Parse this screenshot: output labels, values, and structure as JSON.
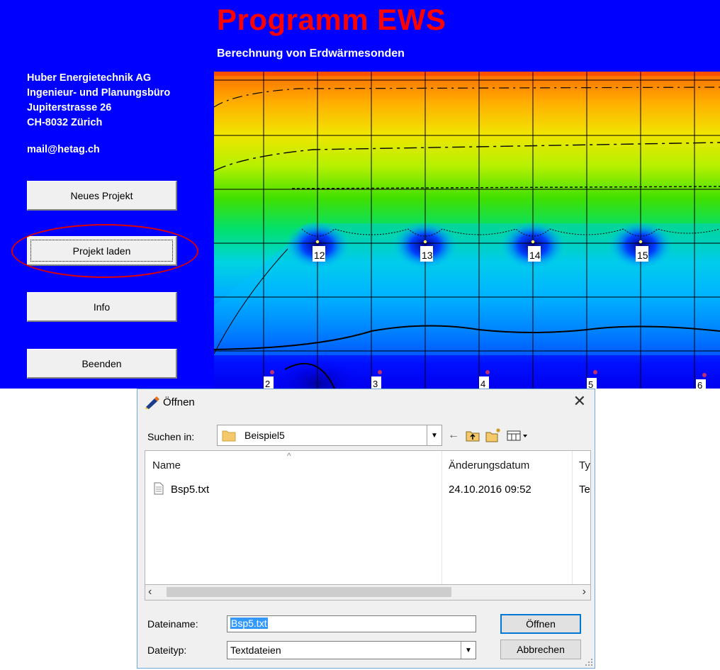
{
  "app": {
    "title": "Programm EWS",
    "subtitle": "Berechnung von Erdwärmesonden",
    "address": [
      "Huber Energietechnik AG",
      "Ingenieur- und Planungsbüro",
      "Jupiterstrasse 26",
      "CH-8032 Zürich"
    ],
    "email": "mail@hetag.ch",
    "buttons": {
      "new": "Neues Projekt",
      "load": "Projekt laden",
      "info": "Info",
      "exit": "Beenden"
    },
    "plot": {
      "upper_probes": [
        "12",
        "13",
        "14",
        "15"
      ],
      "lower_probes": [
        "2",
        "3",
        "4",
        "5",
        "6"
      ]
    }
  },
  "dialog": {
    "title": "Öffnen",
    "look_in_label": "Suchen in:",
    "look_in_value": "Beispiel5",
    "columns": {
      "name": "Name",
      "date": "Änderungsdatum",
      "type": "Ty"
    },
    "files": [
      {
        "name": "Bsp5.txt",
        "date": "24.10.2016 09:52",
        "type": "Te"
      }
    ],
    "filename_label": "Dateiname:",
    "filename_value": "Bsp5.txt",
    "filetype_label": "Dateityp:",
    "filetype_value": "Textdateien",
    "open_button": "Öffnen",
    "cancel_button": "Abbrechen"
  },
  "colors": {
    "app_background": "#0000ff",
    "title_red": "#ff0000",
    "highlight_ring": "#e00000",
    "dialog_background": "#f0f0f0",
    "selection": "#3399ff"
  }
}
